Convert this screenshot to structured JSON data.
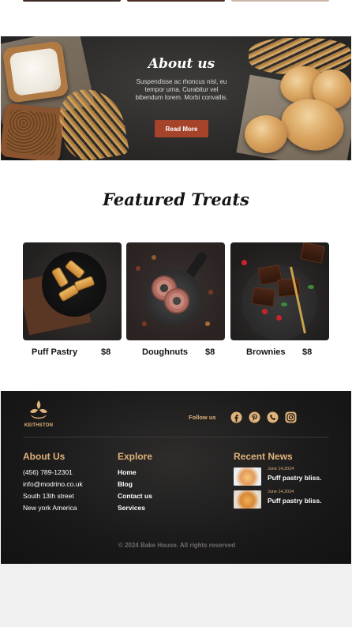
{
  "about": {
    "title": "About us",
    "text": "Suspendisse ac rhoncus nisl, eu tempor urna. Curabitur vel bibendum lorem. Morbi convallis.",
    "button_label": "Read More"
  },
  "featured": {
    "title": "Featured Treats",
    "items": [
      {
        "name": "Puff Pastry",
        "price": "$8"
      },
      {
        "name": "Doughnuts",
        "price": "$8"
      },
      {
        "name": "Brownies",
        "price": "$8"
      }
    ]
  },
  "footer": {
    "logo_text": "KEITHSTON",
    "follow_label": "Follow us",
    "social_icons": [
      "facebook-icon",
      "pinterest-icon",
      "whatsapp-icon",
      "instagram-icon"
    ],
    "about": {
      "heading": "About Us",
      "lines": [
        "(456) 789-12301",
        "info@modrino.co.uk",
        "South 13th street",
        "New york America"
      ]
    },
    "explore": {
      "heading": "Explore",
      "links": [
        "Home",
        "Blog",
        "Contact us",
        "Services"
      ]
    },
    "news": {
      "heading": "Recent News",
      "items": [
        {
          "date": "June 14,2024",
          "title": "Puff pastry bliss."
        },
        {
          "date": "June 14,2024",
          "title": "Puff pastry bliss."
        }
      ]
    },
    "copyright": "© 2024 Bake House. All rights reserved"
  },
  "colors": {
    "accent": "#e0b27a",
    "button": "#a5432b",
    "footer_bg": "#1a1919"
  }
}
